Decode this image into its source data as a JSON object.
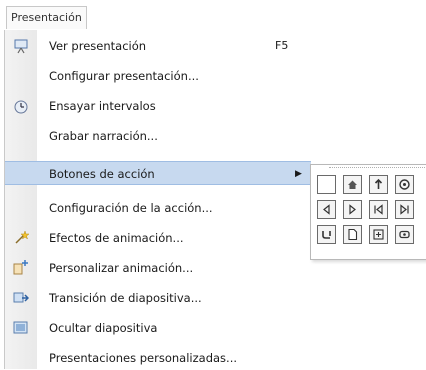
{
  "menubar": {
    "title": "Presentación"
  },
  "menu": {
    "items": [
      {
        "label": "Ver presentación",
        "shortcut": "F5",
        "icon": "slideshow-icon"
      },
      {
        "label": "Configurar presentación...",
        "icon": ""
      },
      {
        "label": "Ensayar intervalos",
        "icon": "rehearse-timings-icon"
      },
      {
        "label": "Grabar narración...",
        "icon": ""
      },
      {
        "label": "Botones de acción",
        "icon": "",
        "submenu": true
      },
      {
        "label": "Configuración de la acción...",
        "icon": ""
      },
      {
        "label": "Efectos de animación...",
        "icon": "animation-effects-icon"
      },
      {
        "label": "Personalizar animación...",
        "icon": "custom-animation-icon"
      },
      {
        "label": "Transición de diapositiva...",
        "icon": "slide-transition-icon"
      },
      {
        "label": "Ocultar diapositiva",
        "icon": "hide-slide-icon"
      },
      {
        "label": "Presentaciones personalizadas...",
        "icon": ""
      }
    ]
  },
  "action_buttons": {
    "rows": [
      [
        "action-custom-icon",
        "action-home-icon",
        "action-help-icon",
        "action-information-icon"
      ],
      [
        "action-back-icon",
        "action-forward-icon",
        "action-beginning-icon",
        "action-end-icon"
      ],
      [
        "action-return-icon",
        "action-document-icon",
        "action-sound-icon",
        "action-movie-icon"
      ]
    ]
  }
}
